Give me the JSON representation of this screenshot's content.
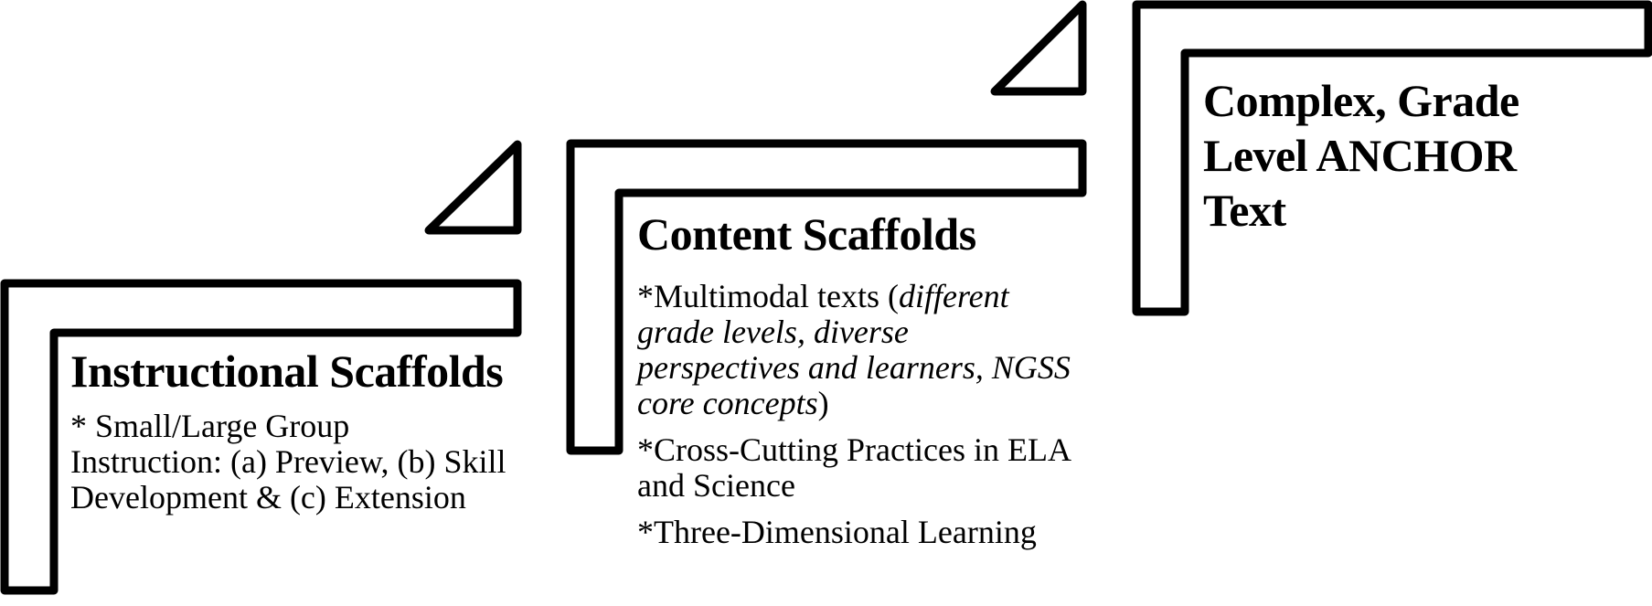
{
  "diagram": {
    "type": "staircase",
    "steps": [
      {
        "id": "instructional",
        "title": "Instructional Scaffolds",
        "items": [
          {
            "text": "* Small/Large Group Instruction: (a) Preview, (b) Skill Development & (c) Extension"
          }
        ]
      },
      {
        "id": "content",
        "title": "Content Scaffolds",
        "items": [
          {
            "prefix": "*Multimodal texts (",
            "italic": "different grade levels, diverse perspectives and learners, NGSS core concepts",
            "suffix": ")"
          },
          {
            "text": "*Cross-Cutting Practices in ELA and Science"
          },
          {
            "text": "*Three-Dimensional Learning"
          }
        ]
      },
      {
        "id": "anchor",
        "title": "Complex, Grade Level ANCHOR Text",
        "items": []
      }
    ],
    "stroke_color": "#000000",
    "background_color": "#ffffff"
  }
}
